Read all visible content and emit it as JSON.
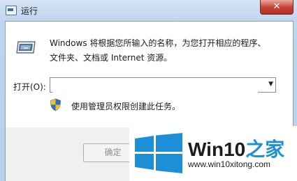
{
  "window": {
    "title": "运行",
    "close_glyph": "✕"
  },
  "dialog": {
    "description_line1": "Windows 将根据您所输入的名称，为您打开相应的程序、",
    "description_line2": "文件夹、文档或 Internet 资源。",
    "open_label": "打开(O):",
    "open_value": "",
    "admin_note": "使用管理员权限创建此任务。",
    "ok_label": "确定"
  },
  "watermark": {
    "brand_main": "Win10",
    "brand_accent": "之家",
    "url": "www.win10xitong.com"
  },
  "icons": {
    "app": "run-app-icon",
    "run": "run-dialog-icon",
    "shield": "uac-shield-icon",
    "logo": "windows-logo-icon"
  },
  "colors": {
    "accent": "#1c8fd6",
    "close": "#c8453a"
  }
}
